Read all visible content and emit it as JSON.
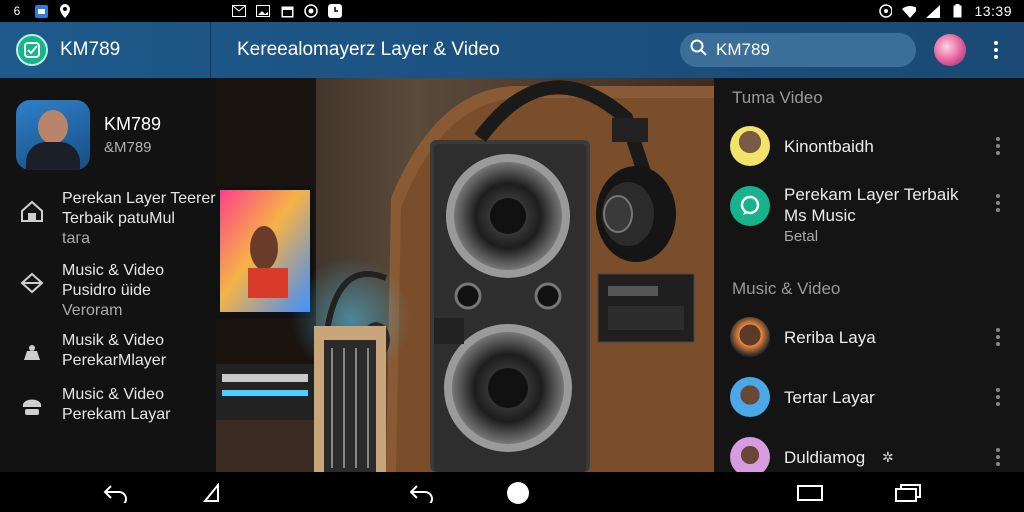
{
  "status_bar": {
    "time": "13:39",
    "left_icons": [
      "sim-icon",
      "image-icon",
      "location-icon"
    ],
    "center_icons": [
      "mail-icon",
      "photo-icon",
      "calendar-icon",
      "record-icon",
      "clock-icon"
    ],
    "right_icons": [
      "hotspot-icon",
      "wifi-icon",
      "signal-icon",
      "battery-icon"
    ],
    "left_text": "6"
  },
  "app_bar": {
    "app_name": "KM789",
    "title": "Kereealomayerz Layer & Video",
    "search_value": "KM789",
    "accent": "#17b38a"
  },
  "drawer": {
    "profile_name": "KM789",
    "profile_sub": "&M789",
    "items": [
      {
        "icon": "home-icon",
        "lines": [
          "Perekan Layer Teerer",
          "Terbaik patuMul",
          "taгa"
        ]
      },
      {
        "icon": "layers-icon",
        "lines": [
          "Music & Video",
          "Pusidro üide",
          "Veroram"
        ]
      },
      {
        "icon": "music-icon",
        "lines": [
          "Musik & Video",
          "PerekarMlayer"
        ]
      },
      {
        "icon": "playlist-icon",
        "lines": [
          "Music & Video",
          "Perekam Layar"
        ]
      }
    ]
  },
  "right_panel": {
    "section1": "Tuma Video",
    "section2": "Music & Video",
    "items1": [
      {
        "name": "Kinontbaidh",
        "sub": "",
        "avatar_color": "#f2e36a"
      },
      {
        "name": "Perekam Layer Terbaik",
        "name2": "Ms Music",
        "sub": "Бetal",
        "avatar_color": "#17b38a"
      }
    ],
    "items2": [
      {
        "name": "Reriba Laya",
        "avatar_color": "#f08a3c"
      },
      {
        "name": "Tertar Layar",
        "avatar_color": "#4aa8e8"
      },
      {
        "name": "Duldiamog",
        "avatar_color": "#d79be0"
      }
    ]
  }
}
